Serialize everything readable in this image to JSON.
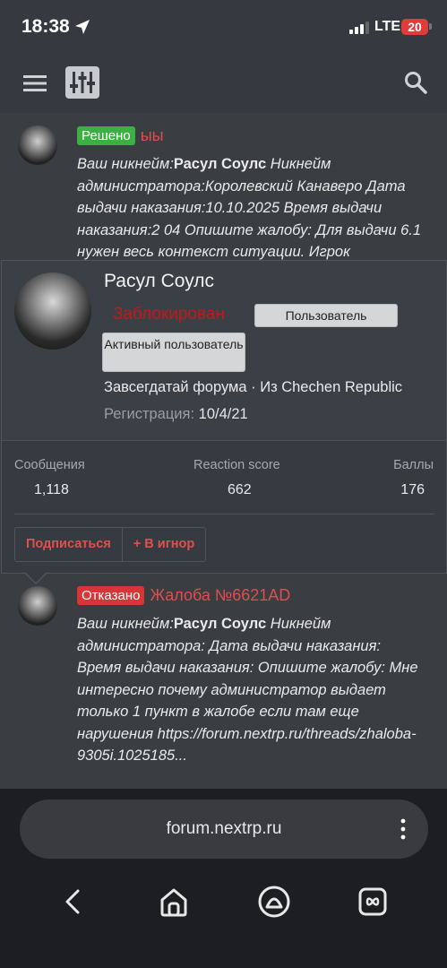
{
  "status_bar": {
    "time": "18:38",
    "network": "LTE",
    "battery": "20"
  },
  "threads": [
    {
      "badge": "Решено",
      "title": "ыы",
      "text_prefix": "Ваш никнейм:",
      "nickname": "Расул Соулс",
      "text_body": " Никнейм администратора:Королевский Канаверо Дата выдачи наказания:10.10.2025 Время выдачи наказания:2 04 Опишите жалобу: Для выдачи 6.1 нужен весь контекст ситуации. Игрок"
    },
    {
      "badge": "Отказано",
      "title": "Жалоба №6621AD",
      "text_prefix": "Ваш никнейм:",
      "nickname": "Расул Соулс",
      "text_body": " Никнейм администратора: Дата выдачи наказания: Время выдачи наказания: Опишите жалобу: Мне интересно почему администратор выдает только 1 пункт в жалобе если там еще нарушения https://forum.nextrp.ru/threads/zhaloba-9305i.1025185..."
    }
  ],
  "member_card": {
    "name": "Расул Соулс",
    "status": "Заблокирован",
    "role_user": "Пользователь",
    "role_active": "Активный пользователь",
    "user_title": "Завсегдатай форума · Из Chechen Republic",
    "reg_label": "Регистрация:",
    "reg_date": "10/4/21",
    "stats": [
      {
        "label": "Сообщения",
        "value": "1,118"
      },
      {
        "label": "Reaction score",
        "value": "662"
      },
      {
        "label": "Баллы",
        "value": "176"
      }
    ],
    "actions": {
      "follow": "Подписаться",
      "ignore": "+ В игнор"
    }
  },
  "browser": {
    "url": "forum.nextrp.ru"
  },
  "icons": [
    "location-arrow-icon",
    "signal-icon",
    "menu-icon",
    "filter-icon",
    "search-icon",
    "more-vertical-icon",
    "back-icon",
    "home-icon",
    "assistant-icon",
    "tabs-icon"
  ],
  "colors": {
    "accent_red": "#e04d4d",
    "blocked_red": "#c41818",
    "solved_green": "#3db043",
    "rejected_red": "#d83636"
  }
}
